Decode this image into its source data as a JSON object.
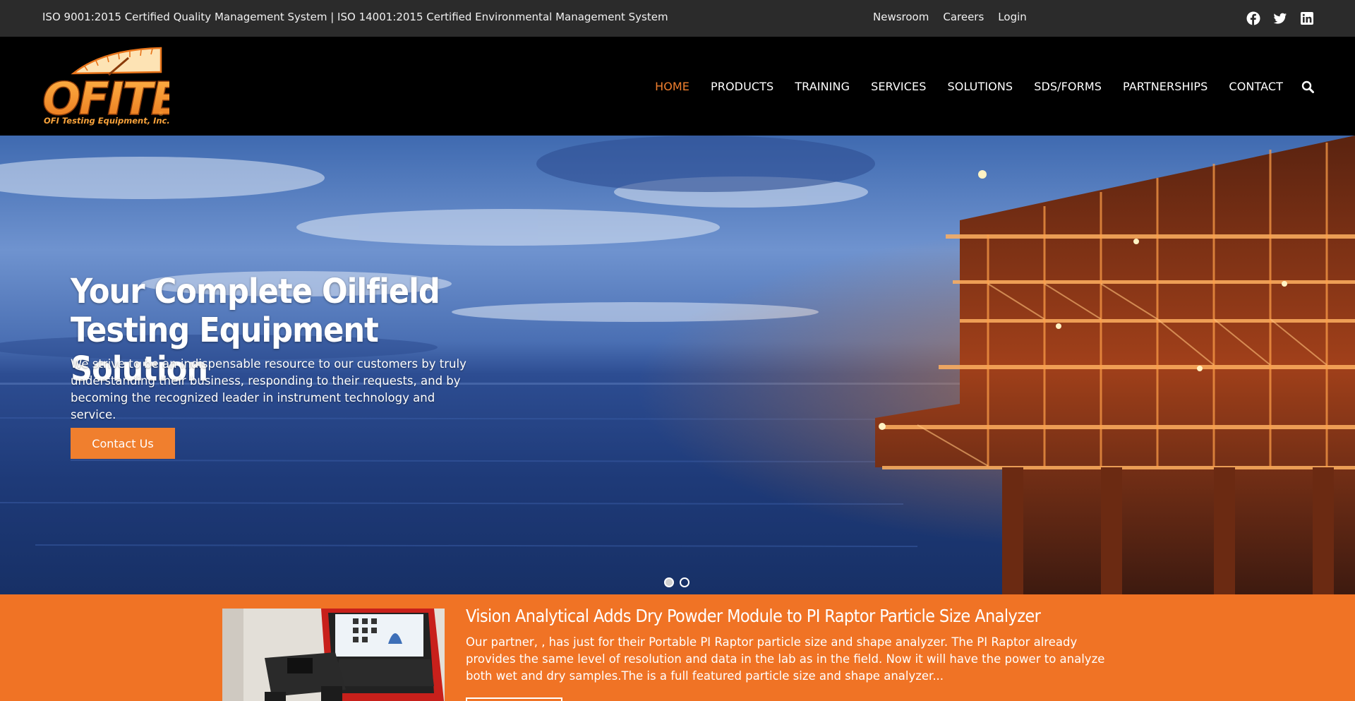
{
  "topbar": {
    "certifications": "ISO 9001:2015 Certified Quality Management System  |  ISO 14001:2015 Certified Environmental Management System",
    "links": [
      "Newsroom",
      "Careers",
      "Login"
    ],
    "social": [
      "facebook-icon",
      "twitter-icon",
      "linkedin-icon"
    ]
  },
  "header": {
    "logo_text": "OFITE",
    "logo_tagline": "OFI Testing Equipment, Inc.",
    "nav": [
      "HOME",
      "PRODUCTS",
      "TRAINING",
      "SERVICES",
      "SOLUTIONS",
      "SDS/FORMS",
      "PARTNERSHIPS",
      "CONTACT"
    ],
    "active_nav": "HOME",
    "accent_color": "#f07f2e"
  },
  "hero": {
    "title": "Your Complete Oilfield Testing Equipment Solution",
    "lead": "We strive to be an indispensable resource to our customers by truly understanding their business, responding to their requests, and by becoming the recognized leader in instrument technology and service.",
    "cta_label": "Contact Us",
    "slide_count": 2,
    "active_slide": 1
  },
  "news": {
    "headline": "Vision Analytical Adds Dry Powder Module to PI Raptor Particle Size Analyzer",
    "body": "Our partner, , has just for their Portable PI Raptor particle size and shape analyzer. The PI Raptor already provides the same level of resolution and data in the lab as in the field. Now it will have the power to analyze both wet and dry samples.The is a full featured particle size and shape analyzer...",
    "band_color": "#f07325"
  }
}
